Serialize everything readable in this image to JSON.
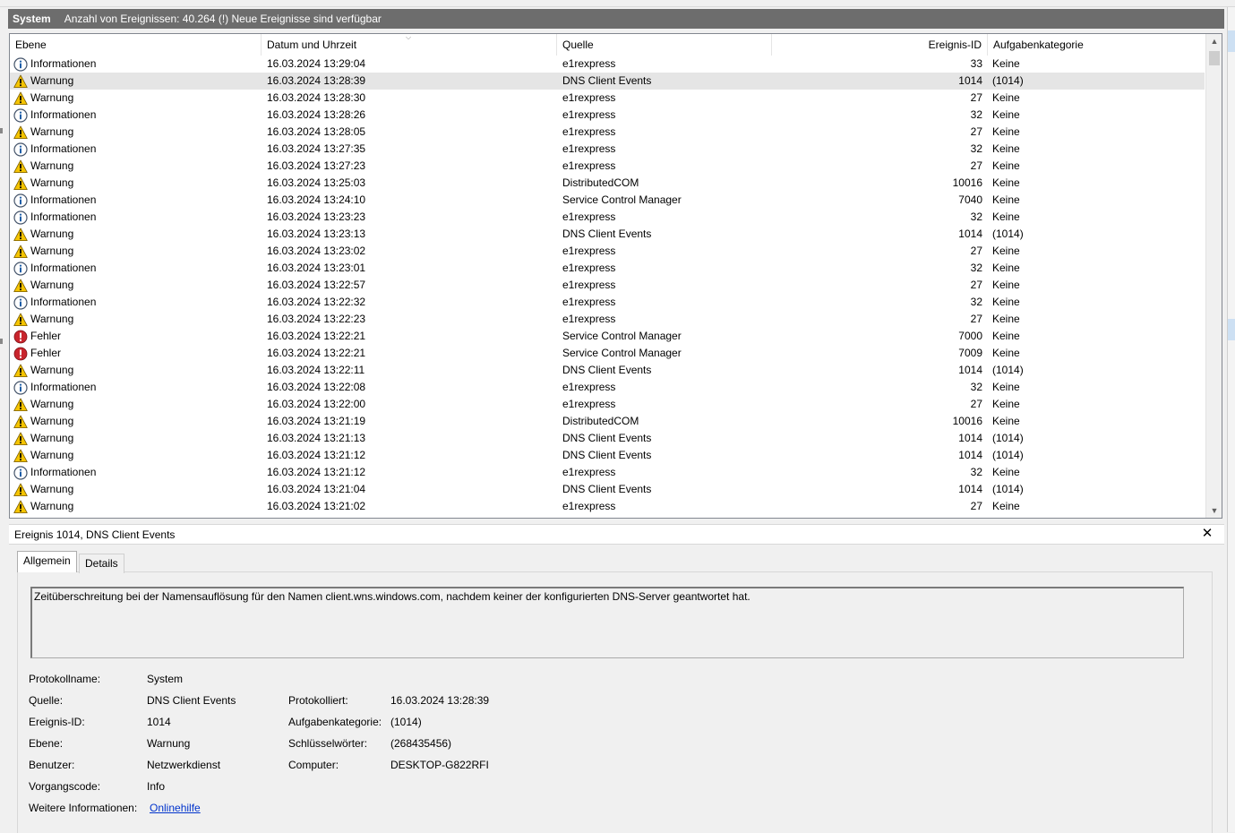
{
  "title_bar": {
    "log_name": "System",
    "info": "Anzahl von Ereignissen: 40.264 (!) Neue Ereignisse sind verfügbar"
  },
  "columns": {
    "level": "Ebene",
    "date": "Datum und Uhrzeit",
    "source": "Quelle",
    "event_id": "Ereignis-ID",
    "category": "Aufgabenkategorie"
  },
  "icons": {
    "info": "info-icon",
    "warning": "warning-icon",
    "error": "error-icon",
    "close": "close-icon",
    "scroll_up": "chevron-up-icon",
    "scroll_down": "chevron-down-icon"
  },
  "colors": {
    "info_blue": "#1f5fa8",
    "warning_yellow": "#f5c400",
    "error_red": "#c9252d",
    "title_bar": "#6d6d6d",
    "selection": "#e5e5e5",
    "link": "#0033cc"
  },
  "rows": [
    {
      "type": "info",
      "level": "Informationen",
      "date": "16.03.2024 13:29:04",
      "source": "e1rexpress",
      "id": "33",
      "category": "Keine"
    },
    {
      "type": "warning",
      "level": "Warnung",
      "date": "16.03.2024 13:28:39",
      "source": "DNS Client Events",
      "id": "1014",
      "category": "(1014)",
      "selected": true
    },
    {
      "type": "warning",
      "level": "Warnung",
      "date": "16.03.2024 13:28:30",
      "source": "e1rexpress",
      "id": "27",
      "category": "Keine"
    },
    {
      "type": "info",
      "level": "Informationen",
      "date": "16.03.2024 13:28:26",
      "source": "e1rexpress",
      "id": "32",
      "category": "Keine"
    },
    {
      "type": "warning",
      "level": "Warnung",
      "date": "16.03.2024 13:28:05",
      "source": "e1rexpress",
      "id": "27",
      "category": "Keine"
    },
    {
      "type": "info",
      "level": "Informationen",
      "date": "16.03.2024 13:27:35",
      "source": "e1rexpress",
      "id": "32",
      "category": "Keine"
    },
    {
      "type": "warning",
      "level": "Warnung",
      "date": "16.03.2024 13:27:23",
      "source": "e1rexpress",
      "id": "27",
      "category": "Keine"
    },
    {
      "type": "warning",
      "level": "Warnung",
      "date": "16.03.2024 13:25:03",
      "source": "DistributedCOM",
      "id": "10016",
      "category": "Keine"
    },
    {
      "type": "info",
      "level": "Informationen",
      "date": "16.03.2024 13:24:10",
      "source": "Service Control Manager",
      "id": "7040",
      "category": "Keine"
    },
    {
      "type": "info",
      "level": "Informationen",
      "date": "16.03.2024 13:23:23",
      "source": "e1rexpress",
      "id": "32",
      "category": "Keine"
    },
    {
      "type": "warning",
      "level": "Warnung",
      "date": "16.03.2024 13:23:13",
      "source": "DNS Client Events",
      "id": "1014",
      "category": "(1014)"
    },
    {
      "type": "warning",
      "level": "Warnung",
      "date": "16.03.2024 13:23:02",
      "source": "e1rexpress",
      "id": "27",
      "category": "Keine"
    },
    {
      "type": "info",
      "level": "Informationen",
      "date": "16.03.2024 13:23:01",
      "source": "e1rexpress",
      "id": "32",
      "category": "Keine"
    },
    {
      "type": "warning",
      "level": "Warnung",
      "date": "16.03.2024 13:22:57",
      "source": "e1rexpress",
      "id": "27",
      "category": "Keine"
    },
    {
      "type": "info",
      "level": "Informationen",
      "date": "16.03.2024 13:22:32",
      "source": "e1rexpress",
      "id": "32",
      "category": "Keine"
    },
    {
      "type": "warning",
      "level": "Warnung",
      "date": "16.03.2024 13:22:23",
      "source": "e1rexpress",
      "id": "27",
      "category": "Keine"
    },
    {
      "type": "error",
      "level": "Fehler",
      "date": "16.03.2024 13:22:21",
      "source": "Service Control Manager",
      "id": "7000",
      "category": "Keine"
    },
    {
      "type": "error",
      "level": "Fehler",
      "date": "16.03.2024 13:22:21",
      "source": "Service Control Manager",
      "id": "7009",
      "category": "Keine"
    },
    {
      "type": "warning",
      "level": "Warnung",
      "date": "16.03.2024 13:22:11",
      "source": "DNS Client Events",
      "id": "1014",
      "category": "(1014)"
    },
    {
      "type": "info",
      "level": "Informationen",
      "date": "16.03.2024 13:22:08",
      "source": "e1rexpress",
      "id": "32",
      "category": "Keine"
    },
    {
      "type": "warning",
      "level": "Warnung",
      "date": "16.03.2024 13:22:00",
      "source": "e1rexpress",
      "id": "27",
      "category": "Keine"
    },
    {
      "type": "warning",
      "level": "Warnung",
      "date": "16.03.2024 13:21:19",
      "source": "DistributedCOM",
      "id": "10016",
      "category": "Keine"
    },
    {
      "type": "warning",
      "level": "Warnung",
      "date": "16.03.2024 13:21:13",
      "source": "DNS Client Events",
      "id": "1014",
      "category": "(1014)"
    },
    {
      "type": "warning",
      "level": "Warnung",
      "date": "16.03.2024 13:21:12",
      "source": "DNS Client Events",
      "id": "1014",
      "category": "(1014)"
    },
    {
      "type": "info",
      "level": "Informationen",
      "date": "16.03.2024 13:21:12",
      "source": "e1rexpress",
      "id": "32",
      "category": "Keine"
    },
    {
      "type": "warning",
      "level": "Warnung",
      "date": "16.03.2024 13:21:04",
      "source": "DNS Client Events",
      "id": "1014",
      "category": "(1014)"
    },
    {
      "type": "warning",
      "level": "Warnung",
      "date": "16.03.2024 13:21:02",
      "source": "e1rexpress",
      "id": "27",
      "category": "Keine"
    }
  ],
  "detail": {
    "title": "Ereignis 1014, DNS Client Events",
    "tabs": {
      "general": "Allgemein",
      "details": "Details"
    },
    "description": "Zeitüberschreitung bei der Namensauflösung für den Namen client.wns.windows.com, nachdem keiner der konfigurierten DNS-Server geantwortet hat.",
    "labels": {
      "log_name": "Protokollname:",
      "source": "Quelle:",
      "event_id": "Ereignis-ID:",
      "level": "Ebene:",
      "user": "Benutzer:",
      "opcode": "Vorgangscode:",
      "more_info": "Weitere Informationen:",
      "logged": "Protokolliert:",
      "task_category": "Aufgabenkategorie:",
      "keywords": "Schlüsselwörter:",
      "computer": "Computer:"
    },
    "values": {
      "log_name": "System",
      "source": "DNS Client Events",
      "event_id": "1014",
      "level": "Warnung",
      "user": "Netzwerkdienst",
      "opcode": "Info",
      "more_info_link": "Onlinehilfe",
      "logged": "16.03.2024 13:28:39",
      "task_category": "(1014)",
      "keywords": "(268435456)",
      "computer": "DESKTOP-G822RFI"
    }
  }
}
